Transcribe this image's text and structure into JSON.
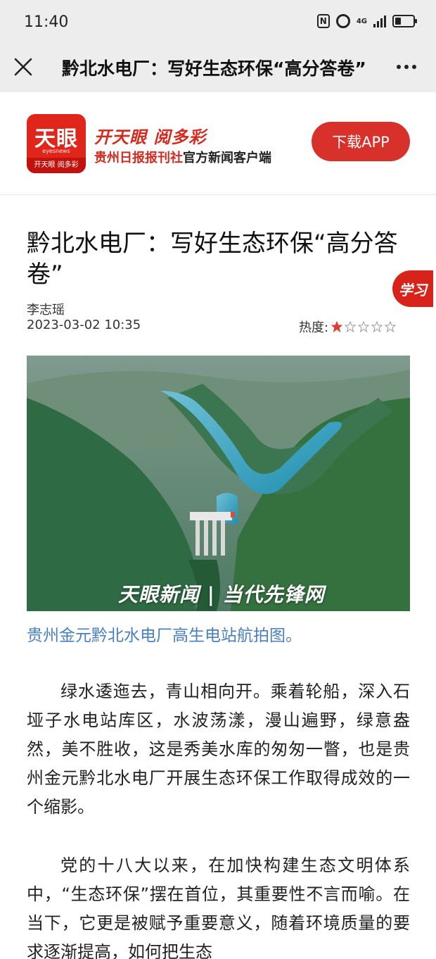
{
  "status": {
    "time": "11:40",
    "network": "4G"
  },
  "nav": {
    "title": "黔北水电厂：写好生态环保“高分答卷”"
  },
  "banner": {
    "logo_text": "天眼",
    "logo_sub": "eyesnews",
    "logo_foot": "开天眼 阅多彩",
    "slogan": "开天眼 阅多彩",
    "slogan2_red": "贵州日报报刊社",
    "slogan2_black": "官方新闻客户端",
    "download_label": "下载APP"
  },
  "article": {
    "title": "黔北水电厂：写好生态环保“高分答卷”",
    "badge": "学习",
    "author": "李志瑶",
    "date": "2023-03-02 10:35",
    "heat_label": "热度:",
    "heat_stars": 1,
    "heat_max": 5,
    "photo_watermark": "天眼新闻 | 当代先锋网",
    "caption": "贵州金元黔北水电厂高生电站航拍图。",
    "paragraphs": [
      "绿水逶迤去，青山相向开。乘着轮船，深入石垭子水电站库区，水波荡漾，漫山遍野，绿意盎然，美不胜收，这是秀美水库的匆匆一瞥，也是贵州金元黔北水电厂开展生态环保工作取得成效的一个缩影。",
      "党的十八大以来，在加快构建生态文明体系中，“生态环保”摆在首位，其重要性不言而喻。在当下，它更是被赋予重要意义，随着环境质量的要求逐渐提高，如何把生态"
    ]
  },
  "colors": {
    "brand_red": "#d8302a",
    "caption_blue": "#4a7fbd"
  }
}
